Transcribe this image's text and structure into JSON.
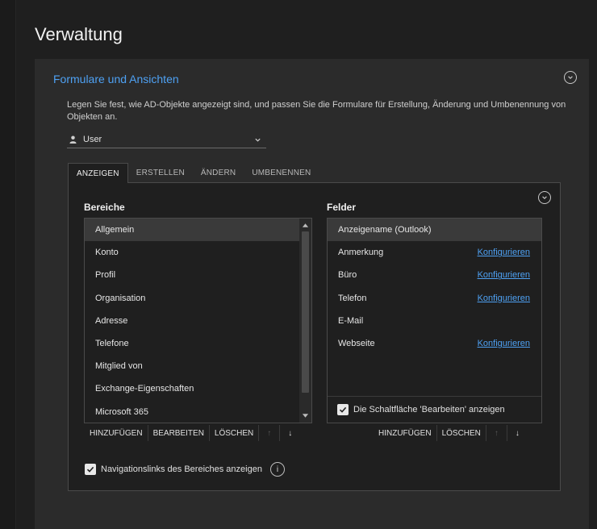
{
  "page": {
    "title": "Verwaltung"
  },
  "panel": {
    "title": "Formulare und Ansichten",
    "description": "Legen Sie fest, wie AD-Objekte angezeigt sind, und passen Sie die Formulare für Erstellung, Änderung und Umbenennung von Objekten an."
  },
  "dropdown": {
    "value": "User",
    "icon": "person-icon"
  },
  "tabs": [
    {
      "label": "ANZEIGEN",
      "active": true
    },
    {
      "label": "ERSTELLEN",
      "active": false
    },
    {
      "label": "ÄNDERN",
      "active": false
    },
    {
      "label": "UMBENENNEN",
      "active": false
    }
  ],
  "bereiche": {
    "title": "Bereiche",
    "items": [
      "Allgemein",
      "Konto",
      "Profil",
      "Organisation",
      "Adresse",
      "Telefone",
      "Mitglied von",
      "Exchange-Eigenschaften",
      "Microsoft 365"
    ],
    "selected": 0,
    "toolbar": {
      "add": "HINZUFÜGEN",
      "edit": "BEARBEITEN",
      "delete": "LÖSCHEN",
      "up": "↑",
      "down": "↓"
    },
    "nav_checkbox": "Navigationslinks des Bereiches anzeigen",
    "info": "i"
  },
  "felder": {
    "title": "Felder",
    "items": [
      {
        "label": "Anzeigename (Outlook)",
        "link": ""
      },
      {
        "label": "Anmerkung",
        "link": "Konfigurieren"
      },
      {
        "label": "Büro",
        "link": "Konfigurieren"
      },
      {
        "label": "Telefon",
        "link": "Konfigurieren"
      },
      {
        "label": "E-Mail",
        "link": ""
      },
      {
        "label": "Webseite",
        "link": "Konfigurieren"
      }
    ],
    "selected": 0,
    "edit_checkbox": "Die Schaltfläche 'Bearbeiten' anzeigen",
    "toolbar": {
      "add": "HINZUFÜGEN",
      "delete": "LÖSCHEN",
      "up": "↑",
      "down": "↓"
    }
  },
  "colors": {
    "accent": "#4ea1f3",
    "background": "#1f1f1f",
    "panel": "#2b2b2b"
  }
}
